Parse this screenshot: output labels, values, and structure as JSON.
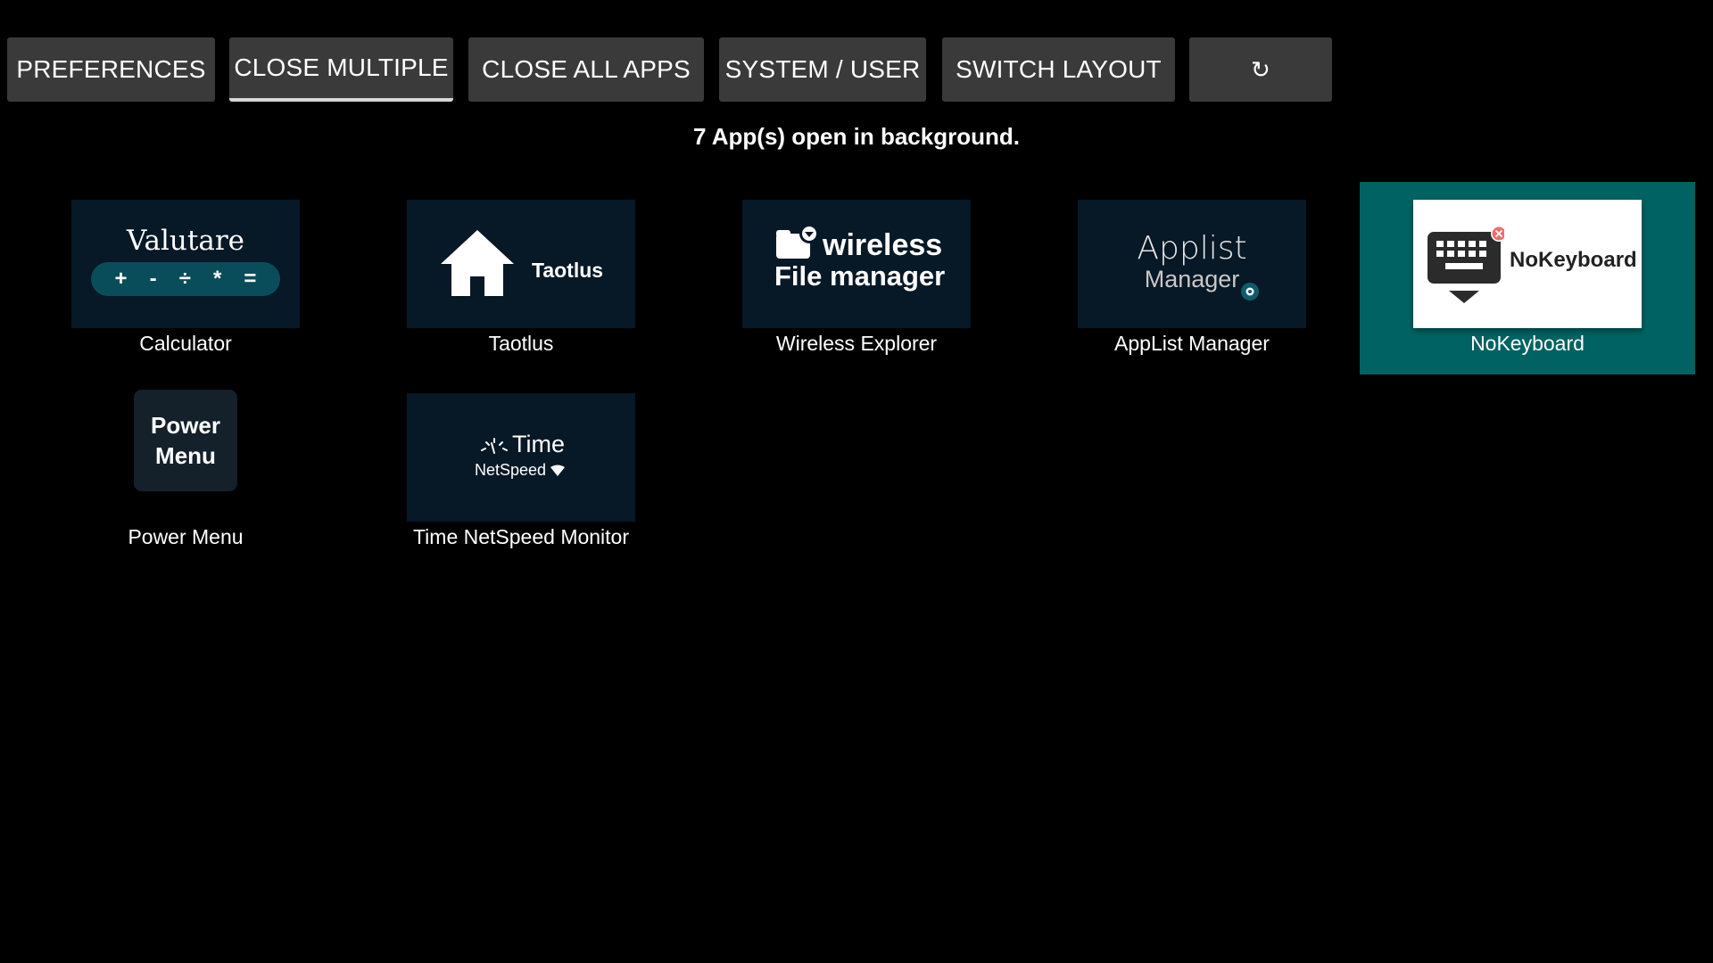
{
  "toolbar": {
    "preferences": "PREFERENCES",
    "close_multiple": "CLOSE MULTIPLE",
    "close_all_apps": "CLOSE ALL APPS",
    "system_user": "SYSTEM / USER",
    "switch_layout": "SWITCH LAYOUT",
    "refresh_icon": "refresh-icon",
    "refresh_glyph": "↻"
  },
  "status": "7 App(s) open in background.",
  "apps": [
    {
      "label": "Calculator",
      "banner": {
        "title": "Valutare",
        "ops": [
          "+",
          "-",
          "÷",
          "*",
          "="
        ]
      }
    },
    {
      "label": "Taotlus",
      "banner": {
        "text": "Taotlus",
        "icon": "house-icon"
      }
    },
    {
      "label": "Wireless Explorer",
      "banner": {
        "line1": "wireless",
        "line2": "File manager",
        "icon": "folder-icon"
      }
    },
    {
      "label": "AppList Manager",
      "banner": {
        "line1": "Applist",
        "line2": "Manager",
        "icon": "gear-icon"
      }
    },
    {
      "label": "NoKeyboard",
      "selected": true,
      "banner": {
        "text": "NoKeyboard",
        "icon": "keyboard-icon"
      }
    },
    {
      "label": "Power Menu",
      "banner": {
        "line1": "Power",
        "line2": "Menu"
      }
    },
    {
      "label": "Time NetSpeed Monitor",
      "banner": {
        "line1": "Time",
        "line2": "NetSpeed",
        "icon": "wifi-icon"
      }
    }
  ],
  "colors": {
    "background": "#000000",
    "button": "#3a3a3a",
    "selected_tile": "#006262",
    "banner": "#071826",
    "calc_pill": "#0a4d5a"
  }
}
